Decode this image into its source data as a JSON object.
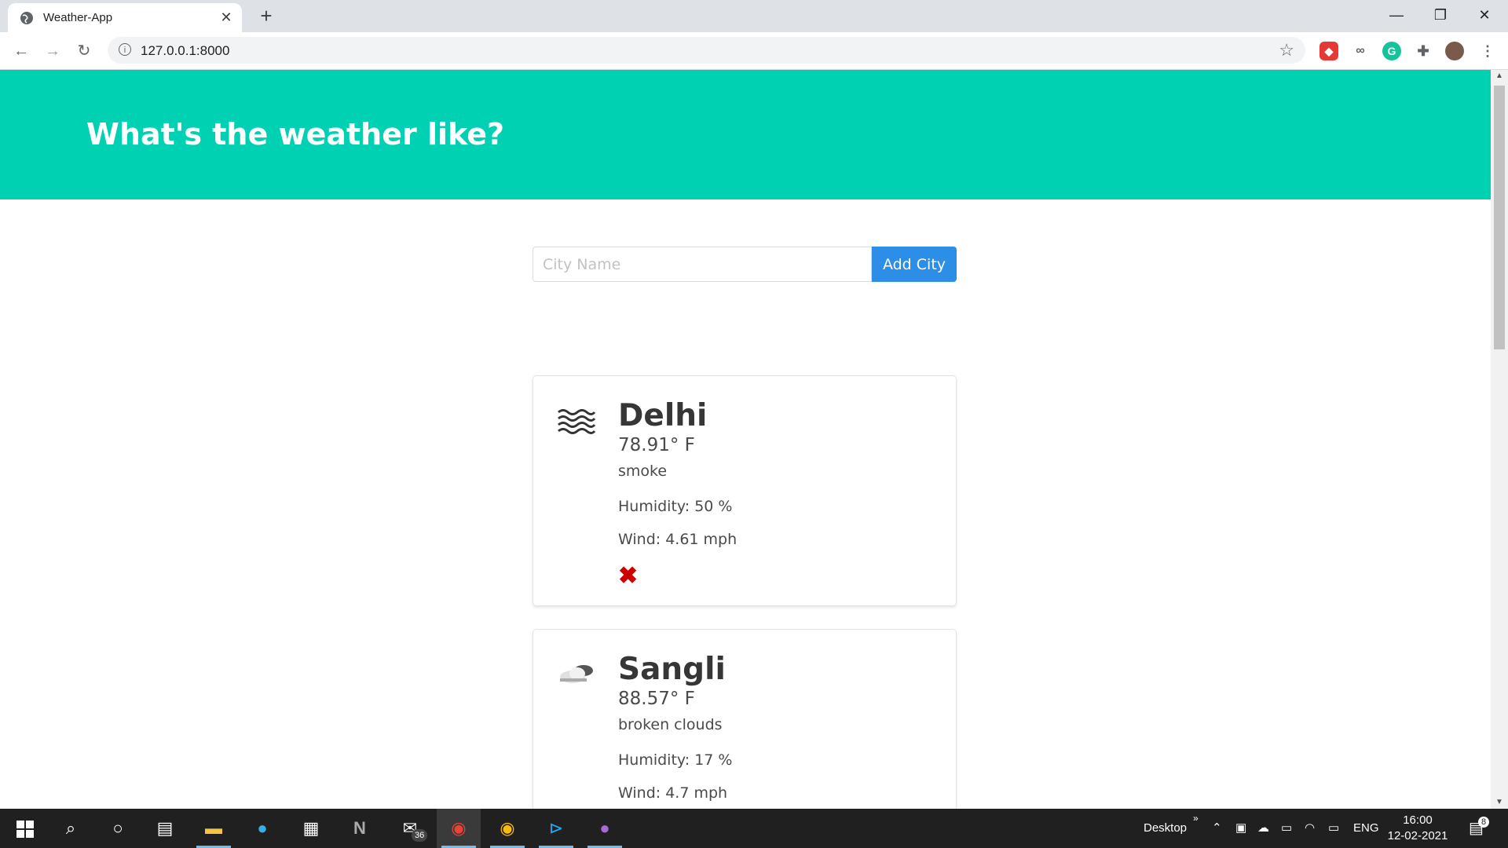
{
  "browser": {
    "tab_title": "Weather-App",
    "url": "127.0.0.1:8000",
    "close_tab_glyph": "✕",
    "new_tab_glyph": "+",
    "window_controls": [
      "—",
      "❐",
      "✕"
    ]
  },
  "page": {
    "heading": "What's the weather like?",
    "form": {
      "placeholder": "City Name",
      "value": "",
      "button_label": "Add City"
    },
    "cards": [
      {
        "city": "Delhi",
        "temperature": "78.91° F",
        "description": "smoke",
        "humidity": "Humidity: 50 %",
        "wind": "Wind: 4.61 mph",
        "icon": "smoke-icon",
        "delete_glyph": "✖"
      },
      {
        "city": "Sangli",
        "temperature": "88.57° F",
        "description": "broken clouds",
        "humidity": "Humidity: 17 %",
        "wind": "Wind: 4.7 mph",
        "icon": "broken-clouds-icon"
      }
    ]
  },
  "taskbar": {
    "mail_badge": "36",
    "desktop_label": "Desktop",
    "language": "ENG",
    "time": "16:00",
    "date": "12-02-2021",
    "notification_count": "8"
  },
  "colors": {
    "hero": "#00d1b2",
    "button": "#2c8ee6",
    "taskbar": "#202020"
  }
}
